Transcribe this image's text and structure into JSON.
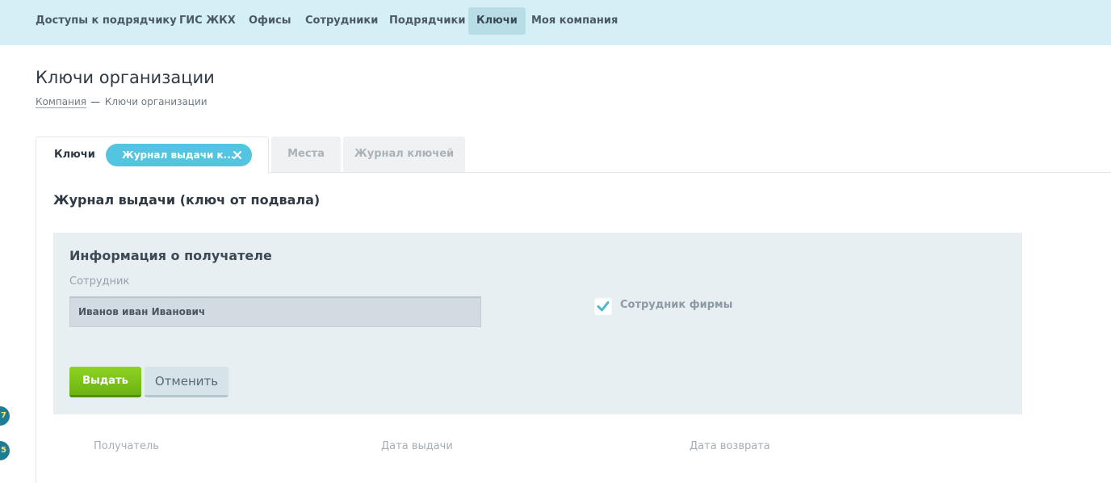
{
  "nav": {
    "items": [
      {
        "label": "Доступы к подрядчику"
      },
      {
        "label": "ГИС ЖКХ"
      },
      {
        "label": "Офисы"
      },
      {
        "label": "Сотрудники"
      },
      {
        "label": "Подрядчики"
      },
      {
        "label": "Ключи",
        "active": true
      },
      {
        "label": "Моя компания"
      }
    ]
  },
  "page": {
    "title": "Ключи организации",
    "breadcrumb": {
      "link": "Компания",
      "separator": "—",
      "current": "Ключи организации"
    }
  },
  "tabs": {
    "active_label": "Ключи",
    "pill_label": "Журнал выдачи к...",
    "items": [
      {
        "label": "Места"
      },
      {
        "label": "Журнал ключей"
      }
    ]
  },
  "section": {
    "title": "Журнал выдачи (ключ от подвала)"
  },
  "recipient": {
    "title": "Информация о получателе",
    "employee_label": "Сотрудник",
    "employee_value": "Иванов иван Иванович",
    "company_employee_label": "Сотрудник фирмы",
    "company_employee_checked": true
  },
  "actions": {
    "issue_label": "Выдать",
    "cancel_label": "Отменить"
  },
  "table": {
    "columns": [
      "Получатель",
      "Дата выдачи",
      "Дата возврата"
    ]
  },
  "side_badges": [
    "7",
    "5"
  ],
  "colors": {
    "nav_bg": "#d4eff6",
    "accent": "#54c5e0",
    "issue_button": "#7cc21a",
    "panel_bg": "#e8eff3",
    "check": "#4fb8cf"
  }
}
